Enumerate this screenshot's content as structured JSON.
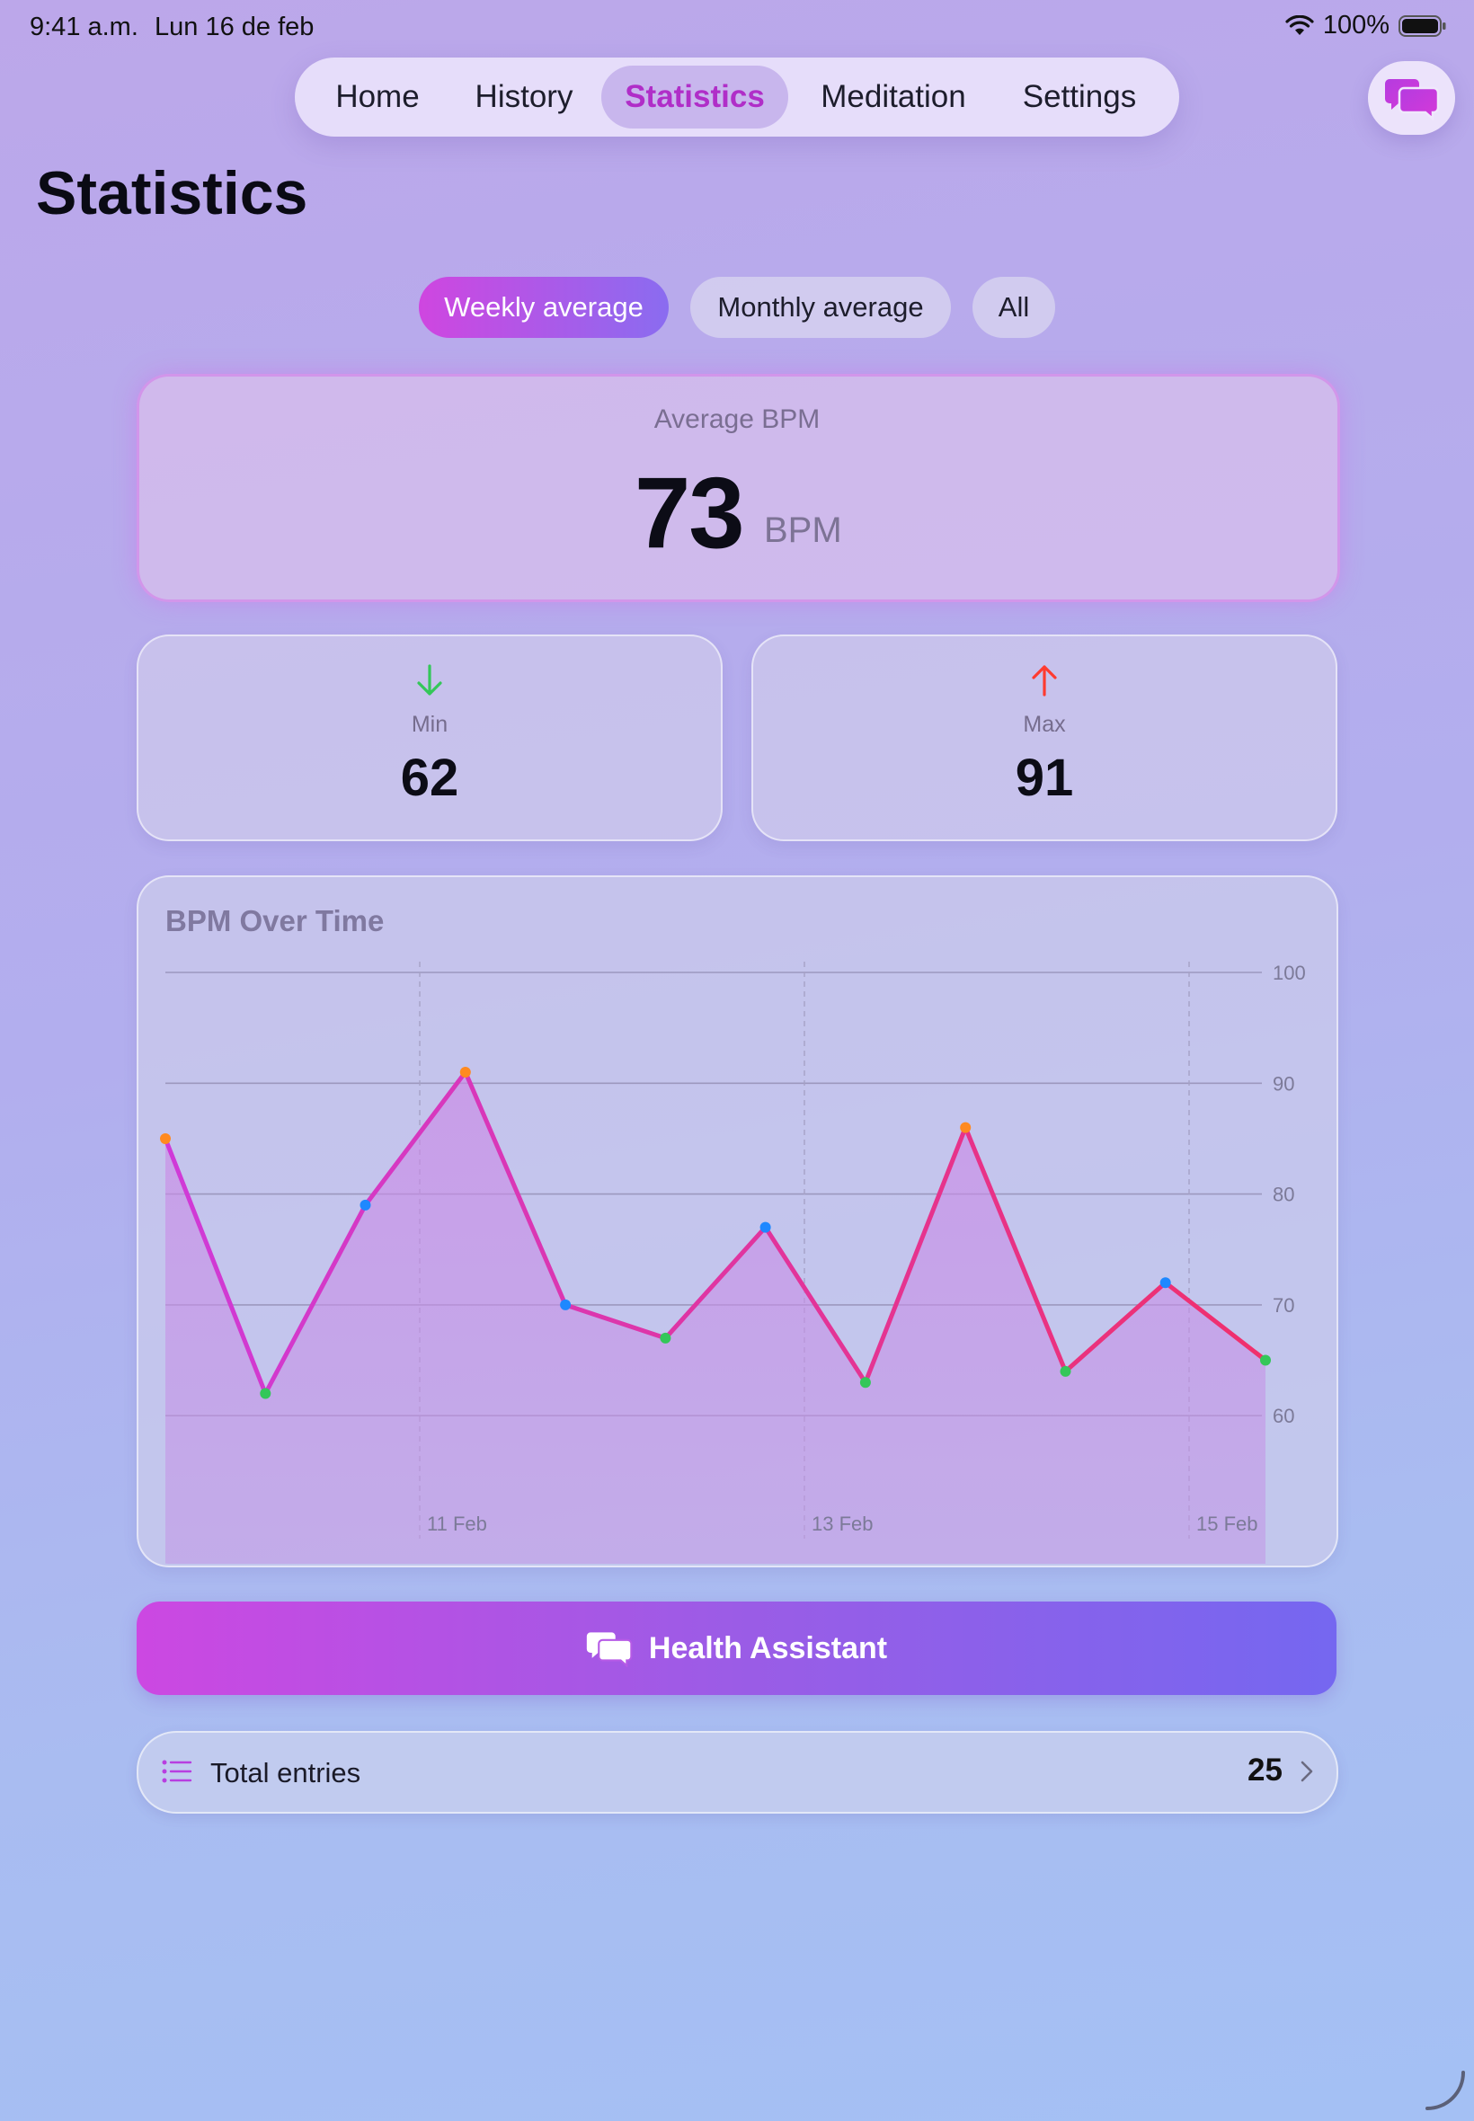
{
  "status_bar": {
    "time": "9:41 a.m.",
    "date": "Lun 16 de feb",
    "battery": "100%"
  },
  "nav": {
    "items": [
      {
        "label": "Home"
      },
      {
        "label": "History"
      },
      {
        "label": "Statistics",
        "active": true
      },
      {
        "label": "Meditation"
      },
      {
        "label": "Settings"
      }
    ]
  },
  "page": {
    "title": "Statistics"
  },
  "filters": {
    "options": [
      "Weekly average",
      "Monthly average",
      "All"
    ],
    "selected": "Weekly average"
  },
  "average": {
    "label": "Average BPM",
    "value": "73",
    "unit": "BPM"
  },
  "min": {
    "label": "Min",
    "value": "62"
  },
  "max": {
    "label": "Max",
    "value": "91"
  },
  "chart_data": {
    "type": "line",
    "title": "BPM Over Time",
    "x_tick_labels": [
      "11 Feb",
      "13 Feb",
      "15 Feb"
    ],
    "y_ticks": [
      100,
      90,
      80,
      70,
      60
    ],
    "ylim": [
      50,
      100
    ],
    "grid": true,
    "values": [
      85,
      62,
      79,
      91,
      70,
      67,
      77,
      63,
      86,
      64,
      72,
      65
    ],
    "point_colors": [
      "#ff8a1f",
      "#34c759",
      "#1e88ff",
      "#ff8a1f",
      "#1e88ff",
      "#34c759",
      "#1e88ff",
      "#34c759",
      "#ff8a1f",
      "#34c759",
      "#1e88ff",
      "#34c759"
    ],
    "line_gradient": [
      "#cf3ad8",
      "#f0306c"
    ]
  },
  "assistant": {
    "label": "Health Assistant"
  },
  "entries": {
    "label": "Total entries",
    "count": "25"
  },
  "colors": {
    "accent": "#b02ec8",
    "min_arrow": "#34c759",
    "max_arrow": "#ff3b30"
  }
}
